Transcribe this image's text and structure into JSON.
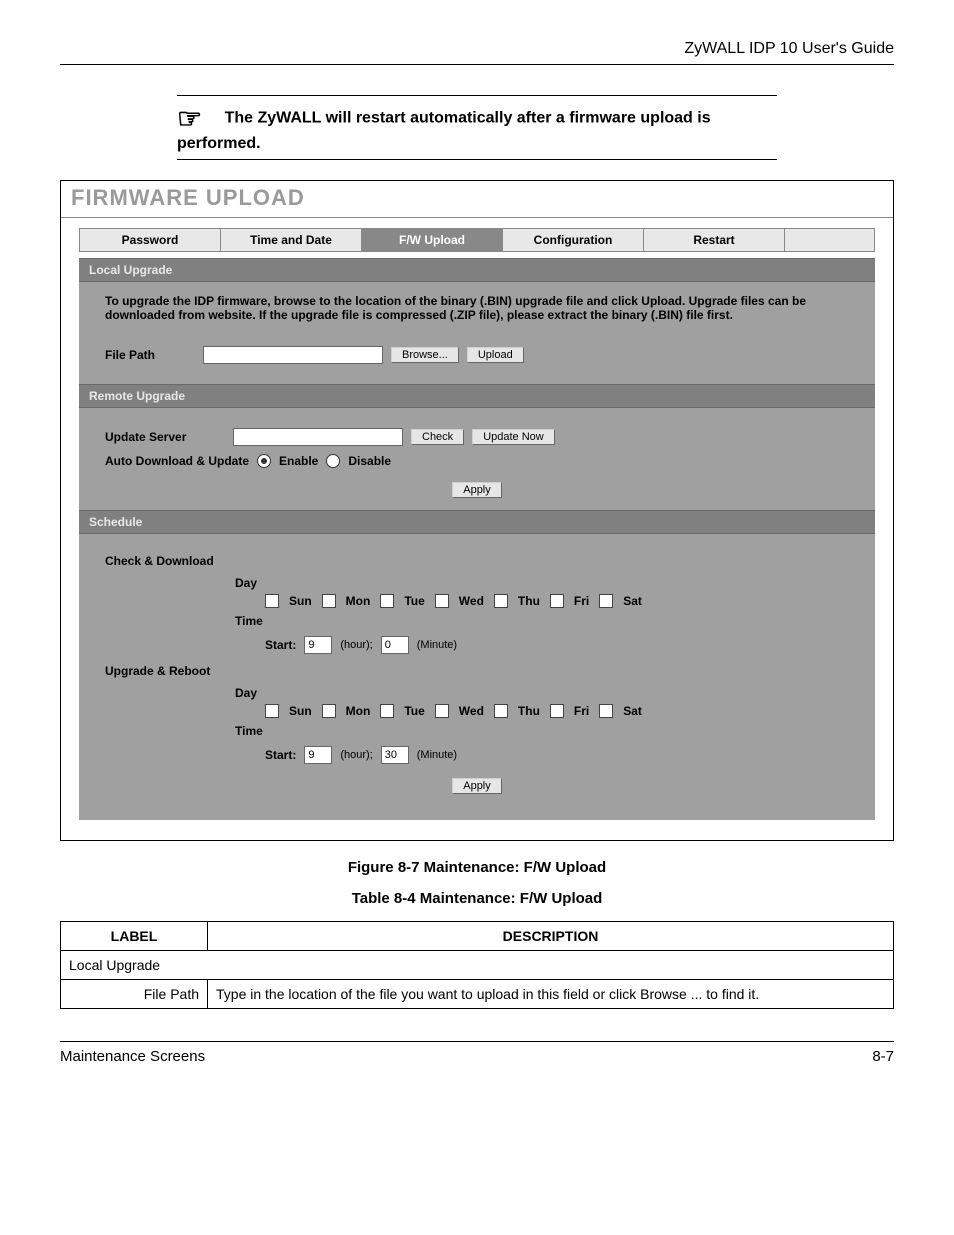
{
  "header": {
    "doc_title": "ZyWALL IDP 10 User's Guide"
  },
  "note": {
    "icon": "☞",
    "text": "The ZyWALL will restart automatically after a firmware upload is performed."
  },
  "fw": {
    "title": "FIRMWARE UPLOAD",
    "tabs": [
      "Password",
      "Time and Date",
      "F/W Upload",
      "Configuration",
      "Restart"
    ],
    "active_tab": "F/W Upload",
    "local": {
      "header": "Local Upgrade",
      "help": "To upgrade the IDP firmware, browse to the location of the binary (.BIN) upgrade file and click Upload. Upgrade files can be downloaded from website. If the upgrade file is compressed (.ZIP file), please extract the binary (.BIN) file first.",
      "file_path_label": "File Path",
      "file_path_value": "",
      "browse": "Browse...",
      "upload": "Upload"
    },
    "remote": {
      "header": "Remote Upgrade",
      "update_server_label": "Update Server",
      "update_server_value": "",
      "check": "Check",
      "update_now": "Update Now",
      "auto_label": "Auto Download & Update",
      "enable": "Enable",
      "disable": "Disable",
      "auto_value": "Enable",
      "apply": "Apply"
    },
    "schedule": {
      "header": "Schedule",
      "check_label": "Check & Download",
      "upgrade_label": "Upgrade & Reboot",
      "day": "Day",
      "time": "Time",
      "start": "Start:",
      "hour": "(hour);",
      "minute": "(Minute)",
      "days": [
        "Sun",
        "Mon",
        "Tue",
        "Wed",
        "Thu",
        "Fri",
        "Sat"
      ],
      "check_hour": "9",
      "check_minute": "0",
      "upgrade_hour": "9",
      "upgrade_minute": "30",
      "apply": "Apply"
    }
  },
  "figure_caption": "Figure 8-7 Maintenance: F/W Upload",
  "table_caption": "Table 8-4 Maintenance: F/W Upload",
  "table": {
    "h1": "LABEL",
    "h2": "DESCRIPTION",
    "rows": [
      {
        "label": "Local Upgrade",
        "desc": ""
      },
      {
        "label": "File Path",
        "desc": "Type in the location of the file you want to upload in this field or click Browse ... to find it."
      }
    ]
  },
  "footer": {
    "left": "Maintenance Screens",
    "right": "8-7"
  }
}
